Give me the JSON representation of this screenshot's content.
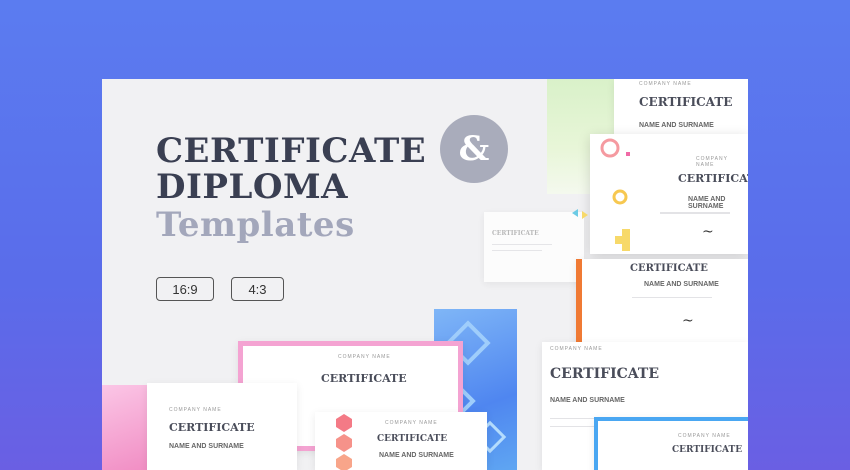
{
  "headline": {
    "line1": "CERTIFICATE",
    "line2": "DIPLOMA",
    "line3": "Templates",
    "ampersand": "&"
  },
  "ratio_options": [
    "16:9",
    "4:3"
  ],
  "certificates": {
    "company_name": "COMPANY NAME",
    "title": "CERTIFICATE",
    "name_line": "NAME AND SURNAME"
  },
  "colors": {
    "background_top": "#5b7cf0",
    "background_bottom": "#6a5fe3",
    "slide": "#f1f1f3",
    "ampersand_circle": "#a9acbb",
    "accent_pink": "#f49ac7",
    "accent_blue": "#5aa7f5",
    "accent_orange": "#f07a34"
  }
}
